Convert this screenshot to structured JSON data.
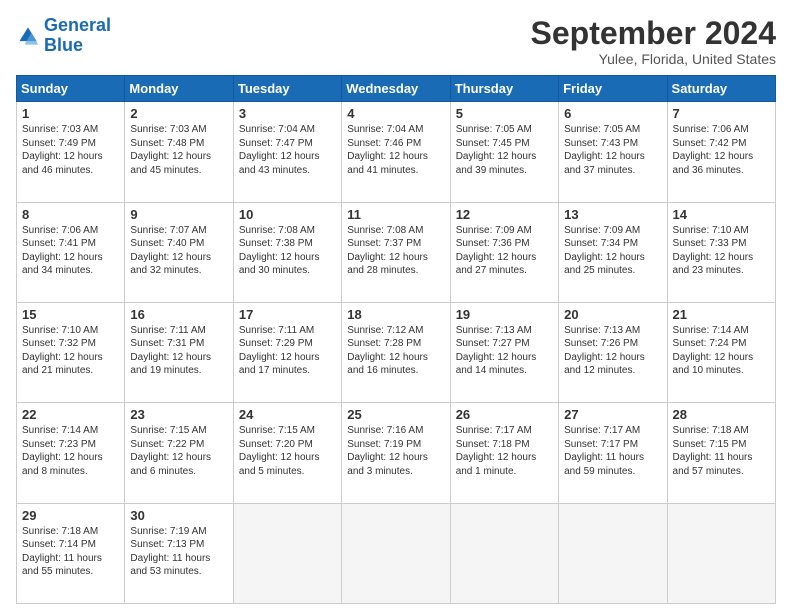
{
  "logo": {
    "line1": "General",
    "line2": "Blue"
  },
  "title": "September 2024",
  "subtitle": "Yulee, Florida, United States",
  "header_days": [
    "Sunday",
    "Monday",
    "Tuesday",
    "Wednesday",
    "Thursday",
    "Friday",
    "Saturday"
  ],
  "weeks": [
    [
      {
        "num": "1",
        "info": "Sunrise: 7:03 AM\nSunset: 7:49 PM\nDaylight: 12 hours\nand 46 minutes."
      },
      {
        "num": "2",
        "info": "Sunrise: 7:03 AM\nSunset: 7:48 PM\nDaylight: 12 hours\nand 45 minutes."
      },
      {
        "num": "3",
        "info": "Sunrise: 7:04 AM\nSunset: 7:47 PM\nDaylight: 12 hours\nand 43 minutes."
      },
      {
        "num": "4",
        "info": "Sunrise: 7:04 AM\nSunset: 7:46 PM\nDaylight: 12 hours\nand 41 minutes."
      },
      {
        "num": "5",
        "info": "Sunrise: 7:05 AM\nSunset: 7:45 PM\nDaylight: 12 hours\nand 39 minutes."
      },
      {
        "num": "6",
        "info": "Sunrise: 7:05 AM\nSunset: 7:43 PM\nDaylight: 12 hours\nand 37 minutes."
      },
      {
        "num": "7",
        "info": "Sunrise: 7:06 AM\nSunset: 7:42 PM\nDaylight: 12 hours\nand 36 minutes."
      }
    ],
    [
      {
        "num": "8",
        "info": "Sunrise: 7:06 AM\nSunset: 7:41 PM\nDaylight: 12 hours\nand 34 minutes."
      },
      {
        "num": "9",
        "info": "Sunrise: 7:07 AM\nSunset: 7:40 PM\nDaylight: 12 hours\nand 32 minutes."
      },
      {
        "num": "10",
        "info": "Sunrise: 7:08 AM\nSunset: 7:38 PM\nDaylight: 12 hours\nand 30 minutes."
      },
      {
        "num": "11",
        "info": "Sunrise: 7:08 AM\nSunset: 7:37 PM\nDaylight: 12 hours\nand 28 minutes."
      },
      {
        "num": "12",
        "info": "Sunrise: 7:09 AM\nSunset: 7:36 PM\nDaylight: 12 hours\nand 27 minutes."
      },
      {
        "num": "13",
        "info": "Sunrise: 7:09 AM\nSunset: 7:34 PM\nDaylight: 12 hours\nand 25 minutes."
      },
      {
        "num": "14",
        "info": "Sunrise: 7:10 AM\nSunset: 7:33 PM\nDaylight: 12 hours\nand 23 minutes."
      }
    ],
    [
      {
        "num": "15",
        "info": "Sunrise: 7:10 AM\nSunset: 7:32 PM\nDaylight: 12 hours\nand 21 minutes."
      },
      {
        "num": "16",
        "info": "Sunrise: 7:11 AM\nSunset: 7:31 PM\nDaylight: 12 hours\nand 19 minutes."
      },
      {
        "num": "17",
        "info": "Sunrise: 7:11 AM\nSunset: 7:29 PM\nDaylight: 12 hours\nand 17 minutes."
      },
      {
        "num": "18",
        "info": "Sunrise: 7:12 AM\nSunset: 7:28 PM\nDaylight: 12 hours\nand 16 minutes."
      },
      {
        "num": "19",
        "info": "Sunrise: 7:13 AM\nSunset: 7:27 PM\nDaylight: 12 hours\nand 14 minutes."
      },
      {
        "num": "20",
        "info": "Sunrise: 7:13 AM\nSunset: 7:26 PM\nDaylight: 12 hours\nand 12 minutes."
      },
      {
        "num": "21",
        "info": "Sunrise: 7:14 AM\nSunset: 7:24 PM\nDaylight: 12 hours\nand 10 minutes."
      }
    ],
    [
      {
        "num": "22",
        "info": "Sunrise: 7:14 AM\nSunset: 7:23 PM\nDaylight: 12 hours\nand 8 minutes."
      },
      {
        "num": "23",
        "info": "Sunrise: 7:15 AM\nSunset: 7:22 PM\nDaylight: 12 hours\nand 6 minutes."
      },
      {
        "num": "24",
        "info": "Sunrise: 7:15 AM\nSunset: 7:20 PM\nDaylight: 12 hours\nand 5 minutes."
      },
      {
        "num": "25",
        "info": "Sunrise: 7:16 AM\nSunset: 7:19 PM\nDaylight: 12 hours\nand 3 minutes."
      },
      {
        "num": "26",
        "info": "Sunrise: 7:17 AM\nSunset: 7:18 PM\nDaylight: 12 hours\nand 1 minute."
      },
      {
        "num": "27",
        "info": "Sunrise: 7:17 AM\nSunset: 7:17 PM\nDaylight: 11 hours\nand 59 minutes."
      },
      {
        "num": "28",
        "info": "Sunrise: 7:18 AM\nSunset: 7:15 PM\nDaylight: 11 hours\nand 57 minutes."
      }
    ],
    [
      {
        "num": "29",
        "info": "Sunrise: 7:18 AM\nSunset: 7:14 PM\nDaylight: 11 hours\nand 55 minutes."
      },
      {
        "num": "30",
        "info": "Sunrise: 7:19 AM\nSunset: 7:13 PM\nDaylight: 11 hours\nand 53 minutes."
      },
      {
        "num": "",
        "info": ""
      },
      {
        "num": "",
        "info": ""
      },
      {
        "num": "",
        "info": ""
      },
      {
        "num": "",
        "info": ""
      },
      {
        "num": "",
        "info": ""
      }
    ]
  ]
}
